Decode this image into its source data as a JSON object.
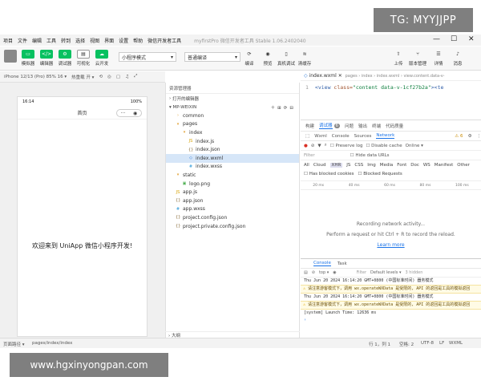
{
  "watermark_top": "TG: MYYJJPP",
  "watermark_bottom": "www.hgxinyongpan.com",
  "menubar": {
    "items": [
      "项目",
      "文件",
      "编辑",
      "工具",
      "转到",
      "选择",
      "视图",
      "界面",
      "设置",
      "帮助",
      "微信开发者工具"
    ],
    "title": "myfirstPro   微信开发者工具 Stable 1.06.2402040"
  },
  "toolbar": {
    "simulator": "模拟器",
    "editor": "编辑器",
    "debugger": "调试器",
    "visual": "可视化",
    "cloud": "云开发",
    "mode_select": "小程序模式",
    "compile_select": "普通编译",
    "compile": "编译",
    "preview": "预览",
    "real_debug": "真机调试",
    "clear_cache": "清缓存",
    "upload": "上传",
    "version": "版本管理",
    "details": "详情",
    "messages": "消息"
  },
  "devbar": {
    "device": "iPhone 12/13 (Pro) 85% 16 ▾",
    "hot_reload": "热重载 开 ▾"
  },
  "phone": {
    "time": "16:14",
    "battery": "100%",
    "nav_title": "首页",
    "content": "欢迎来到 UniApp 微信小程序开发!"
  },
  "explorer": {
    "header": "资源管理器",
    "open_editors": "打开的编辑器",
    "project": "MP-WEIXIN",
    "outline": "大纲",
    "tree": [
      {
        "label": "common",
        "indent": 1,
        "icon": "›",
        "cls": "c-folder"
      },
      {
        "label": "pages",
        "indent": 1,
        "icon": "▾",
        "cls": "c-folder"
      },
      {
        "label": "index",
        "indent": 2,
        "icon": "▾",
        "cls": "c-folder"
      },
      {
        "label": "index.js",
        "indent": 3,
        "icon": "JS",
        "cls": "c-js"
      },
      {
        "label": "index.json",
        "indent": 3,
        "icon": "{}",
        "cls": "c-json"
      },
      {
        "label": "index.wxml",
        "indent": 3,
        "icon": "◇",
        "cls": "c-wxml",
        "selected": true
      },
      {
        "label": "index.wxss",
        "indent": 3,
        "icon": "#",
        "cls": "c-wxss"
      },
      {
        "label": "static",
        "indent": 1,
        "icon": "▾",
        "cls": "c-folder"
      },
      {
        "label": "logo.png",
        "indent": 2,
        "icon": "▣",
        "cls": "c-img"
      },
      {
        "label": "app.js",
        "indent": 1,
        "icon": "JS",
        "cls": "c-js"
      },
      {
        "label": "app.json",
        "indent": 1,
        "icon": "{}",
        "cls": "c-json"
      },
      {
        "label": "app.wxss",
        "indent": 1,
        "icon": "#",
        "cls": "c-wxss"
      },
      {
        "label": "project.config.json",
        "indent": 1,
        "icon": "{}",
        "cls": "c-json"
      },
      {
        "label": "project.private.config.json",
        "indent": 1,
        "icon": "{}",
        "cls": "c-json"
      }
    ]
  },
  "editor": {
    "tab": "index.wxml",
    "breadcrumb": "pages › index › index.wxml › view.content.data-v-",
    "line_number": "1",
    "code_tag": "<view",
    "code_attr": " class=",
    "code_str": "\"content data-v-1cf27b2a\"",
    "code_rest": "><te"
  },
  "devtools": {
    "tabs": [
      "构建",
      "调试器",
      "问题",
      "输出",
      "终端",
      "代码质量"
    ],
    "badge": "6",
    "subtabs": [
      "Wxml",
      "Console",
      "Sources",
      "Network"
    ],
    "warn_count": "6",
    "preserve_log": "Preserve log",
    "disable_cache": "Disable cache",
    "online": "Online",
    "filter": "Filter",
    "hide_data_urls": "Hide data URLs",
    "types": [
      "All",
      "Cloud",
      "XHR",
      "JS",
      "CSS",
      "Img",
      "Media",
      "Font",
      "Doc",
      "WS",
      "Manifest",
      "Other"
    ],
    "blocked_cookies": "Has blocked cookies",
    "blocked_requests": "Blocked Requests",
    "timeline": [
      "20 ms",
      "40 ms",
      "60 ms",
      "80 ms",
      "100 ms"
    ],
    "recording": "Recording network activity...",
    "perform": "Perform a request or hit Ctrl + R to record the reload.",
    "learn_more": "Learn more"
  },
  "console": {
    "tabs": [
      "Console",
      "Task"
    ],
    "context": "top",
    "filter": "Filter",
    "levels": "Default levels",
    "hidden": "3 hidden",
    "logs": [
      {
        "text": "Thu Jun 20 2024 16:14:20 GMT+0800 (中国标准时间) 器务模式",
        "warn": false
      },
      {
        "text": "请注意游客模式下，调用 wx.operateWXData 是受限的, API 的返回是工具的模拟返回",
        "warn": true
      },
      {
        "text": "Thu Jun 20 2024 16:14:20 GMT+0800 (中国标准时间) 器务模式",
        "warn": false
      },
      {
        "text": "请注意游客模式下，调用 wx.operateWXData 是受限的, API 的返回是工具的模拟返回",
        "warn": true
      },
      {
        "text": "[system] Launch Time: 12636 ms",
        "warn": false
      }
    ]
  },
  "statusbar": {
    "path_label": "页面路径 ▾",
    "path": "pages/index/index",
    "position": "行 1，列 1",
    "spaces": "空格: 2",
    "encoding": "UTF-8",
    "eol": "LF",
    "lang": "WXML"
  }
}
